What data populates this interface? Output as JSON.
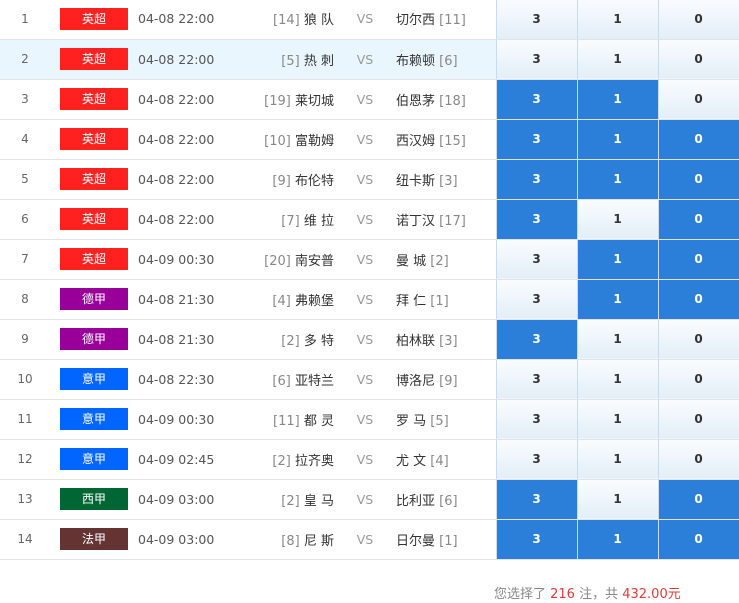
{
  "vs_label": "VS",
  "colors": {
    "selected_cell": "#2b7fd9",
    "highlight_row": "#e9f6fd",
    "amount_red": "#e03a3a"
  },
  "league_colors": {
    "英超": "#ff2020",
    "德甲": "#990099",
    "意甲": "#0066ff",
    "西甲": "#006633",
    "法甲": "#663333"
  },
  "matches": [
    {
      "num": "1",
      "league": "英超",
      "time": "04-08 22:00",
      "home_rank": "[14]",
      "home": "狼 队",
      "away": "切尔西",
      "away_rank": "[11]",
      "odds": [
        "3",
        "1",
        "0"
      ],
      "selected": [
        false,
        false,
        false
      ],
      "highlight": false
    },
    {
      "num": "2",
      "league": "英超",
      "time": "04-08 22:00",
      "home_rank": "[5]",
      "home": "热 刺",
      "away": "布赖顿",
      "away_rank": "[6]",
      "odds": [
        "3",
        "1",
        "0"
      ],
      "selected": [
        false,
        false,
        false
      ],
      "highlight": true
    },
    {
      "num": "3",
      "league": "英超",
      "time": "04-08 22:00",
      "home_rank": "[19]",
      "home": "莱切城",
      "away": "伯恩茅",
      "away_rank": "[18]",
      "odds": [
        "3",
        "1",
        "0"
      ],
      "selected": [
        true,
        true,
        false
      ],
      "highlight": false
    },
    {
      "num": "4",
      "league": "英超",
      "time": "04-08 22:00",
      "home_rank": "[10]",
      "home": "富勒姆",
      "away": "西汉姆",
      "away_rank": "[15]",
      "odds": [
        "3",
        "1",
        "0"
      ],
      "selected": [
        true,
        true,
        true
      ],
      "highlight": false
    },
    {
      "num": "5",
      "league": "英超",
      "time": "04-08 22:00",
      "home_rank": "[9]",
      "home": "布伦特",
      "away": "纽卡斯",
      "away_rank": "[3]",
      "odds": [
        "3",
        "1",
        "0"
      ],
      "selected": [
        true,
        true,
        true
      ],
      "highlight": false
    },
    {
      "num": "6",
      "league": "英超",
      "time": "04-08 22:00",
      "home_rank": "[7]",
      "home": "维 拉",
      "away": "诺丁汉",
      "away_rank": "[17]",
      "odds": [
        "3",
        "1",
        "0"
      ],
      "selected": [
        true,
        false,
        true
      ],
      "highlight": false
    },
    {
      "num": "7",
      "league": "英超",
      "time": "04-09 00:30",
      "home_rank": "[20]",
      "home": "南安普",
      "away": "曼 城",
      "away_rank": "[2]",
      "odds": [
        "3",
        "1",
        "0"
      ],
      "selected": [
        false,
        true,
        true
      ],
      "highlight": false
    },
    {
      "num": "8",
      "league": "德甲",
      "time": "04-08 21:30",
      "home_rank": "[4]",
      "home": "弗赖堡",
      "away": "拜 仁",
      "away_rank": "[1]",
      "odds": [
        "3",
        "1",
        "0"
      ],
      "selected": [
        false,
        true,
        true
      ],
      "highlight": false
    },
    {
      "num": "9",
      "league": "德甲",
      "time": "04-08 21:30",
      "home_rank": "[2]",
      "home": "多 特",
      "away": "柏林联",
      "away_rank": "[3]",
      "odds": [
        "3",
        "1",
        "0"
      ],
      "selected": [
        true,
        false,
        false
      ],
      "highlight": false
    },
    {
      "num": "10",
      "league": "意甲",
      "time": "04-08 22:30",
      "home_rank": "[6]",
      "home": "亚特兰",
      "away": "博洛尼",
      "away_rank": "[9]",
      "odds": [
        "3",
        "1",
        "0"
      ],
      "selected": [
        false,
        false,
        false
      ],
      "highlight": false
    },
    {
      "num": "11",
      "league": "意甲",
      "time": "04-09 00:30",
      "home_rank": "[11]",
      "home": "都 灵",
      "away": "罗 马",
      "away_rank": "[5]",
      "odds": [
        "3",
        "1",
        "0"
      ],
      "selected": [
        false,
        false,
        false
      ],
      "highlight": false
    },
    {
      "num": "12",
      "league": "意甲",
      "time": "04-09 02:45",
      "home_rank": "[2]",
      "home": "拉齐奥",
      "away": "尤 文",
      "away_rank": "[4]",
      "odds": [
        "3",
        "1",
        "0"
      ],
      "selected": [
        false,
        false,
        false
      ],
      "highlight": false
    },
    {
      "num": "13",
      "league": "西甲",
      "time": "04-09 03:00",
      "home_rank": "[2]",
      "home": "皇 马",
      "away": "比利亚",
      "away_rank": "[6]",
      "odds": [
        "3",
        "1",
        "0"
      ],
      "selected": [
        true,
        false,
        true
      ],
      "highlight": false
    },
    {
      "num": "14",
      "league": "法甲",
      "time": "04-09 03:00",
      "home_rank": "[8]",
      "home": "尼 斯",
      "away": "日尔曼",
      "away_rank": "[1]",
      "odds": [
        "3",
        "1",
        "0"
      ],
      "selected": [
        true,
        true,
        true
      ],
      "highlight": false
    }
  ],
  "summary": {
    "prefix": "您选择了 ",
    "count": "216",
    "mid": " 注，共 ",
    "amount": "432.00元"
  }
}
